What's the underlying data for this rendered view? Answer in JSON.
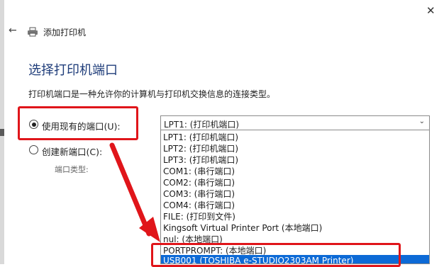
{
  "wizard": {
    "title": "添加打印机",
    "heading": "选择打印机端口",
    "description": "打印机端口是一种允许你的计算机与打印机交换信息的连接类型。"
  },
  "options": {
    "use_existing_label": "使用现有的端口(U):",
    "create_new_label": "创建新端口(C):",
    "port_type_label": "端口类型:"
  },
  "port_select": {
    "selected": "LPT1: (打印机端口)",
    "items": [
      "LPT1: (打印机端口)",
      "LPT2: (打印机端口)",
      "LPT3: (打印机端口)",
      "COM1: (串行端口)",
      "COM2: (串行端口)",
      "COM3: (串行端口)",
      "COM4: (串行端口)",
      "FILE: (打印到文件)",
      "Kingsoft Virtual Printer Port (本地端口)",
      "nul: (本地端口)",
      "PORTPROMPT: (本地端口)",
      "USB001 (TOSHIBA e-STUDIO2303AM Printer)"
    ],
    "highlighted_index": 11
  },
  "colors": {
    "accent": "#0d6ad6",
    "annotation": "#e0151a",
    "heading": "#1f3d7a"
  }
}
